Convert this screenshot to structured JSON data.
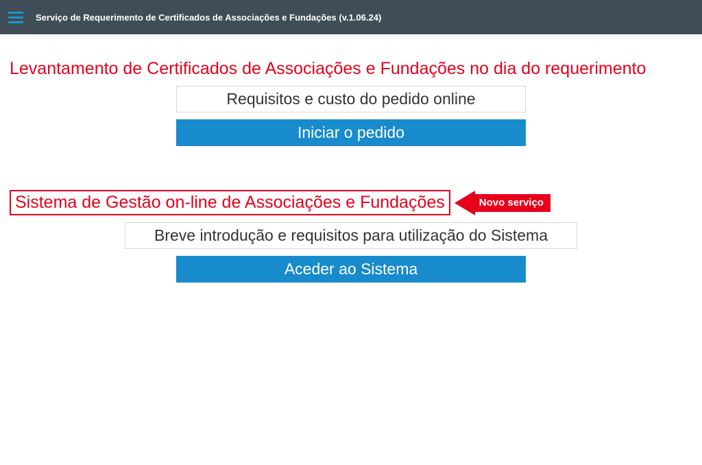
{
  "header": {
    "title": "Serviço de Requerimento de Certificados de Associações e Fundações (v.1.06.24)"
  },
  "section1": {
    "title": "Levantamento de Certificados de Associações e Fundações no dia do requerimento",
    "requirements_button": "Requisitos e custo do pedido online",
    "start_button": "Iniciar o pedido"
  },
  "section2": {
    "title": "Sistema de Gestão on-line de Associações e Fundações",
    "badge": "Novo serviço",
    "intro_button": "Breve introdução e requisitos para utilização do Sistema",
    "access_button": "Aceder ao Sistema"
  }
}
